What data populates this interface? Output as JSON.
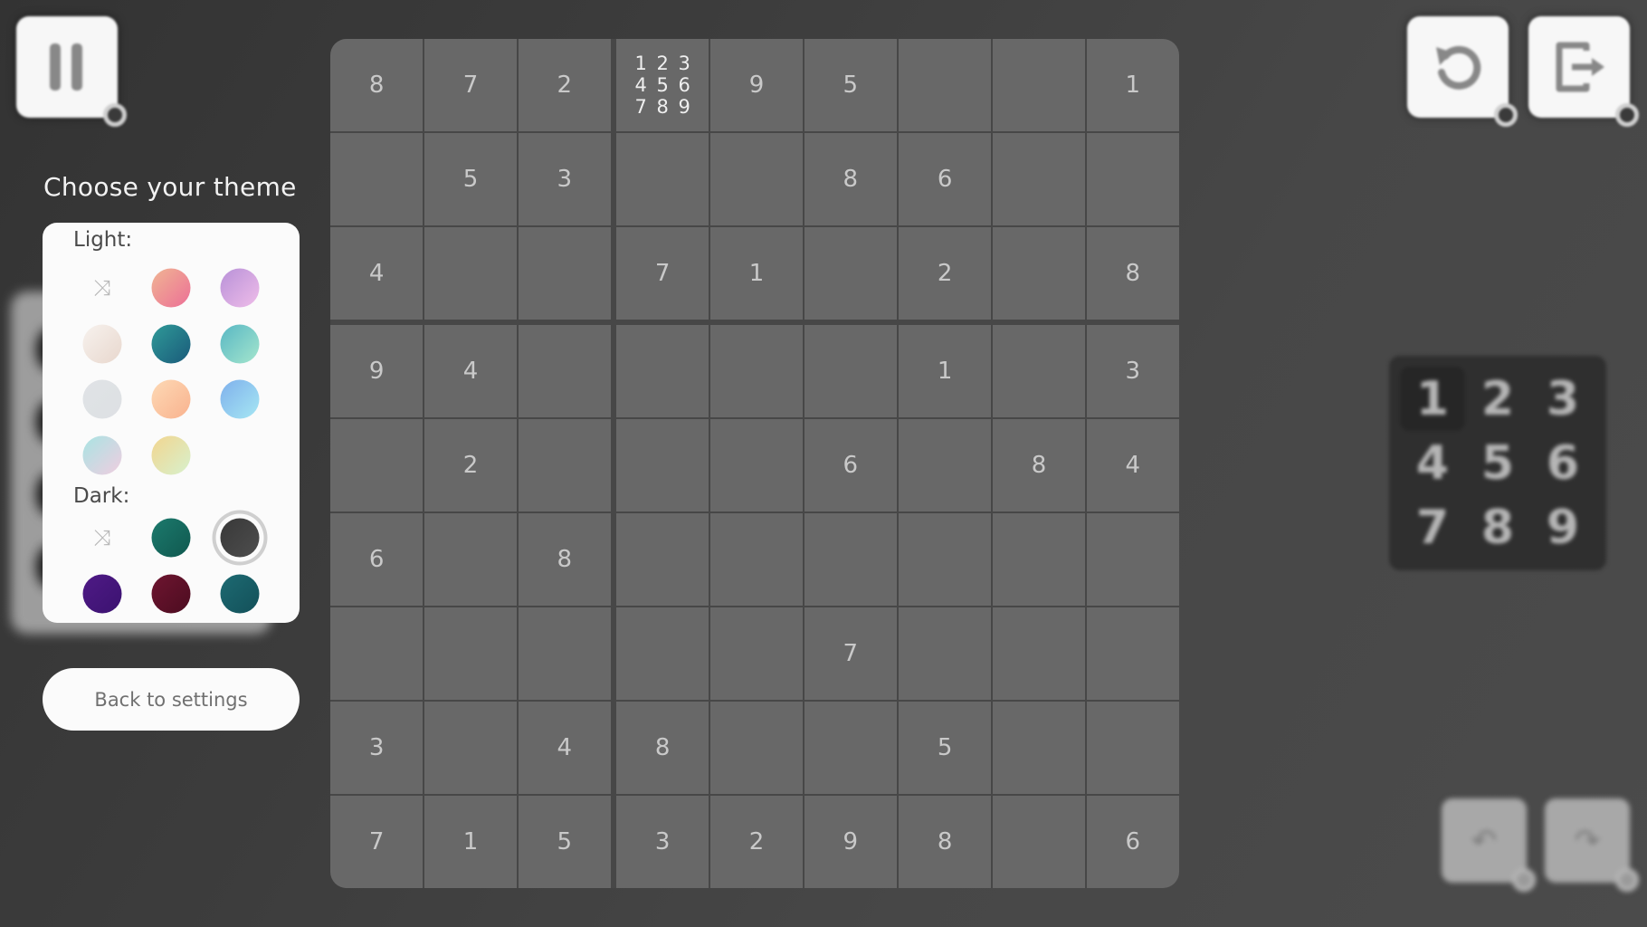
{
  "top_bar": {
    "pause_icon": "pause-icon",
    "restart_icon": "restart-icon",
    "exit_icon": "exit-icon"
  },
  "theme_picker": {
    "title": "Choose your theme",
    "light_label": "Light:",
    "dark_label": "Dark:",
    "shuffle_glyph": "⤨",
    "light_swatches": [
      {
        "name": "random",
        "type": "shuffle"
      },
      {
        "name": "pink-peach",
        "from": "#f0b593",
        "to": "#ec6f96"
      },
      {
        "name": "lavender",
        "from": "#b891d8",
        "to": "#efbde9"
      },
      {
        "name": "cream",
        "from": "#f7f2ee",
        "to": "#e8d7cd"
      },
      {
        "name": "deep-teal",
        "from": "#2f9a98",
        "to": "#1a5a7a"
      },
      {
        "name": "aqua-mint",
        "from": "#58b7c4",
        "to": "#a5e6cd"
      },
      {
        "name": "light-grey",
        "from": "#e0e3e6",
        "to": "#dde0e3"
      },
      {
        "name": "peach",
        "from": "#fdd9b5",
        "to": "#f9b28e"
      },
      {
        "name": "sky-blue",
        "from": "#7fb0ec",
        "to": "#a6e7f3"
      },
      {
        "name": "ice-pink",
        "from": "#a8e4e3",
        "to": "#f0cde0"
      },
      {
        "name": "lemon-mint",
        "from": "#f2d58f",
        "to": "#d7f1cd"
      }
    ],
    "dark_swatches": [
      {
        "name": "random",
        "type": "shuffle"
      },
      {
        "name": "dark-green",
        "from": "#1c7a6d",
        "to": "#10584f"
      },
      {
        "name": "charcoal",
        "from": "#383838",
        "to": "#4e4e4e",
        "selected": true
      },
      {
        "name": "purple",
        "from": "#4f1a86",
        "to": "#3b1270"
      },
      {
        "name": "maroon",
        "from": "#6e1530",
        "to": "#4c0c20"
      },
      {
        "name": "dark-teal",
        "from": "#1d6a72",
        "to": "#135059"
      }
    ],
    "back_button": "Back to settings"
  },
  "sudoku": {
    "rows": [
      [
        "8",
        "7",
        "2",
        "",
        "9",
        "5",
        "",
        "",
        "1"
      ],
      [
        "",
        "5",
        "3",
        "",
        "",
        "8",
        "6",
        "",
        ""
      ],
      [
        "4",
        "",
        "",
        "7",
        "1",
        "",
        "2",
        "",
        "8"
      ],
      [
        "9",
        "4",
        "",
        "",
        "",
        "",
        "1",
        "",
        "3"
      ],
      [
        "",
        "2",
        "",
        "",
        "",
        "6",
        "",
        "8",
        "4"
      ],
      [
        "6",
        "",
        "8",
        "",
        "",
        "",
        "",
        "",
        ""
      ],
      [
        "",
        "",
        "",
        "",
        "",
        "7",
        "",
        "",
        ""
      ],
      [
        "3",
        "",
        "4",
        "8",
        "",
        "",
        "5",
        "",
        ""
      ],
      [
        "7",
        "1",
        "5",
        "3",
        "2",
        "9",
        "8",
        "",
        "6"
      ]
    ],
    "notes": [
      {
        "row": 0,
        "col": 3,
        "values": [
          "1",
          "2",
          "3",
          "4",
          "5",
          "6",
          "7",
          "8",
          "9"
        ]
      }
    ]
  },
  "numpad": {
    "keys": [
      "1",
      "2",
      "3",
      "4",
      "5",
      "6",
      "7",
      "8",
      "9"
    ],
    "active_key": "1"
  },
  "history": {
    "undo_glyph": "↶",
    "redo_glyph": "↷"
  },
  "colors": {
    "background": "#3c3c3c",
    "cell": "#686868",
    "cell_text": "#c9c9c9",
    "panel": "#fbfbfb"
  }
}
